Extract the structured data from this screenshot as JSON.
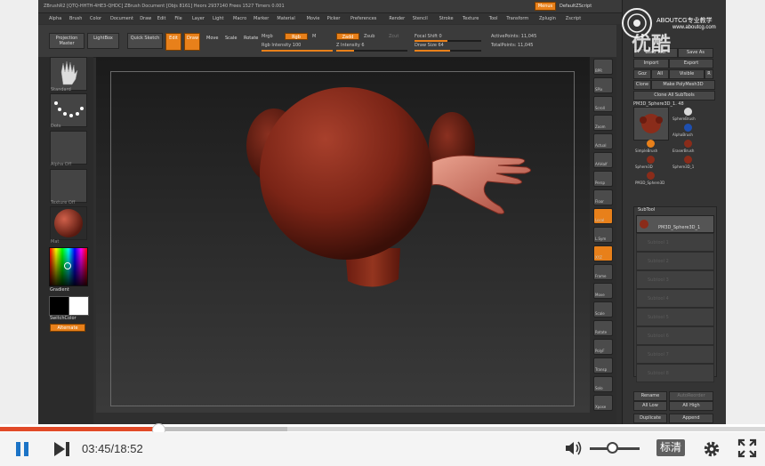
{
  "app": {
    "title": "ZBrushR2 [QTQ-HHTH-4HE3-QHDC]  ZBrush Document  [Objs 8161] Heors 2937140 Frees 1527 Timers 0.001",
    "top_right_buttons": [
      "Menus",
      "DefaultZScript"
    ],
    "menus": [
      "Alpha",
      "Brush",
      "Color",
      "Document",
      "Draw",
      "Edit",
      "File",
      "Layer",
      "Light",
      "Macro",
      "Marker",
      "Material",
      "Movie",
      "Picker",
      "Preferences",
      "Render",
      "Stencil",
      "Stroke",
      "Texture",
      "Tool",
      "Transform",
      "Zplugin",
      "Zscript"
    ]
  },
  "top_shelf": {
    "projection_master": "Projection Master",
    "lightbox": "LightBox",
    "quick_sketch": "Quick Sketch",
    "edit": "Edit",
    "draw": "Draw",
    "move": "Move",
    "scale": "Scale",
    "rotate": "Rotate",
    "mrgb": "Mrgb",
    "rgb": "Rgb",
    "m": "M",
    "rgb_intensity": "Rgb Intensity 100",
    "zadd": "Zadd",
    "zsub": "Zsub",
    "zcut": "Zcut",
    "z_intensity": "Z Intensity 6",
    "focal_shift": "Focal Shift 0",
    "draw_size": "Draw Size 64",
    "active_points": "ActivePoints: 11,045",
    "total_points": "TotalPoints: 11,045"
  },
  "left_shelf": {
    "brush_label": "Standard",
    "stroke_label": "Dots",
    "alpha_label": "Alpha Off",
    "texture_label": "Texture Off",
    "material_label": "Mat",
    "gradient_label": "Gradient",
    "switch_color_label": "SwitchColor",
    "alternate_label": "Alternate"
  },
  "right_shelf": [
    "BPR",
    "SPix",
    "Scroll",
    "Zoom",
    "Actual",
    "AAHalf",
    "Persp",
    "Floor",
    "Local",
    "L.Sym",
    "XYZ",
    "Frame",
    "Move",
    "Scale",
    "Rotate",
    "PolyF",
    "Transp",
    "Solo",
    "Xpose"
  ],
  "tool_tray": {
    "header_buttons": [
      "Load Tool",
      "Save As",
      "Import",
      "Export",
      "Goz",
      "All",
      "Visible",
      "R"
    ],
    "clone": "Clone",
    "make_polymesh": "Make PolyMesh3D",
    "clone_all_subtools": "Clone All SubTools",
    "current_tool": "PM3D_Sphere3D_1. 48",
    "tools": [
      "SphereBrush",
      "AlphaBrush",
      "SimpleBrush",
      "EraserBrush",
      "Sphere3D",
      "Sphere3D_1",
      "PM3D_Sphere3D"
    ],
    "subtool_header": "SubTool",
    "subtool_item": "PM3D_Sphere3D_1",
    "subtool_slots": [
      "Subtool 1",
      "Subtool 2",
      "Subtool 3",
      "Subtool 4",
      "Subtool 5",
      "Subtool 6",
      "Subtool 7",
      "Subtool 8"
    ],
    "bottom_buttons": [
      "Rename",
      "AutoReorder",
      "All Low",
      "All High",
      "Duplicate",
      "Append"
    ]
  },
  "watermark": {
    "line1": "ABOUTCG专业教学",
    "line2": "优酷",
    "line3": "www.aboutcg.com"
  },
  "player": {
    "current_time": "03:45",
    "total_time": "18:52",
    "time_display": "03:45/18:52",
    "quality": "标清",
    "progress_fraction": 0.207,
    "buffered_fraction": 0.376,
    "volume_fraction": 0.45
  },
  "colors": {
    "accent_orange": "#e8801a",
    "progress_red": "#e14a28",
    "model_red": "#8f2f1d"
  },
  "icons": {
    "play_pause": "pause-icon",
    "next": "next-icon",
    "volume": "volume-icon",
    "settings": "gear-icon",
    "fullscreen": "fullscreen-icon"
  }
}
